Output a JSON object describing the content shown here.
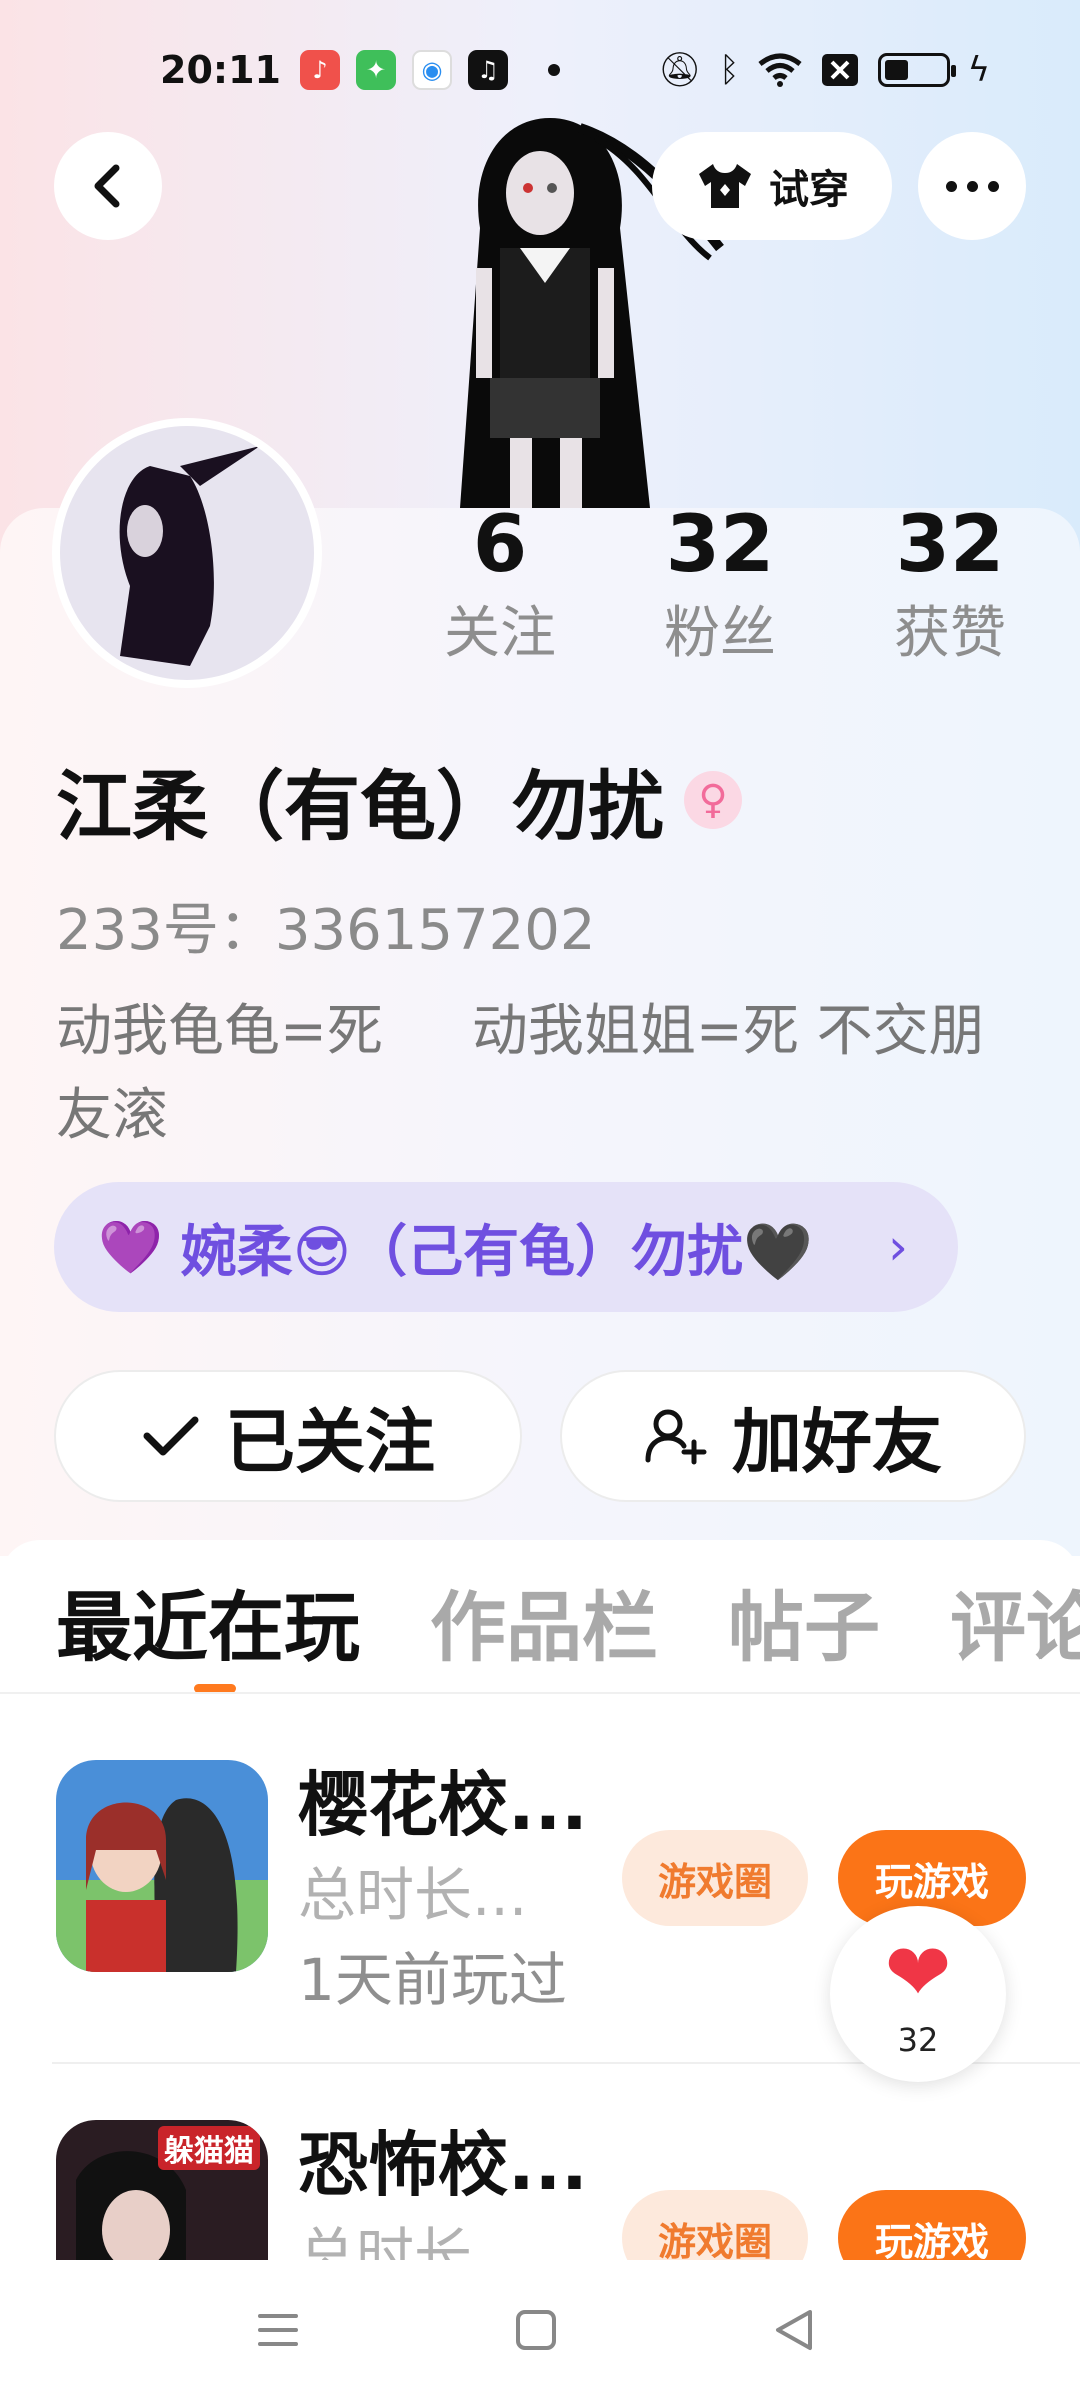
{
  "status_bar": {
    "time": "20:11",
    "app_icons": [
      "music-app-icon",
      "game-app-icon",
      "search-app-icon",
      "tiktok-app-icon"
    ],
    "battery_level": 0.4
  },
  "header": {
    "tryon_label": "试穿"
  },
  "profile": {
    "stats": [
      {
        "num": "6",
        "label": "关注"
      },
      {
        "num": "32",
        "label": "粉丝"
      },
      {
        "num": "32",
        "label": "获赞"
      }
    ],
    "name": "江柔（有龟）勿扰",
    "gender_symbol": "♀",
    "account_id": "233号：336157202",
    "bio": "动我龟龟=死     动我姐姐=死 不交朋友滚",
    "partner_text": "婉柔😎（己有龟）勿扰🖤"
  },
  "actions": {
    "follow_label": "已关注",
    "add_friend_label": "加好友"
  },
  "tabs": [
    "最近在玩",
    "作品栏",
    "帖子",
    "评论"
  ],
  "active_tab": 0,
  "games": [
    {
      "title": "樱花校...",
      "total_time": "总时长...",
      "last_played": "1天前玩过",
      "circle_label": "游戏圈",
      "play_label": "玩游戏"
    },
    {
      "title": "恐怖校...",
      "total_time": "总时长...",
      "last_played": "",
      "circle_label": "游戏圈",
      "play_label": "玩游戏",
      "thumb_badge": "躲猫猫"
    }
  ],
  "like_fab": {
    "count": "32"
  },
  "colors": {
    "accent_orange": "#fb7417",
    "partner_purple": "#6f4fe0",
    "like_red": "#f03646"
  }
}
